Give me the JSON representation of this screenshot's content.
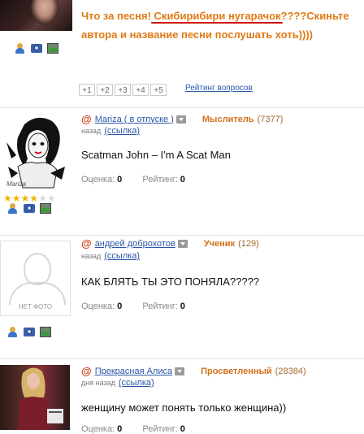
{
  "question": {
    "text_before": "Что за песня! ",
    "text_highlight": "Скибирибири нугарачок",
    "text_after": "????Скиньте автора и название песни послушать хоть))))",
    "votes": [
      "+1",
      "+2",
      "+3",
      "+4",
      "+5"
    ],
    "rating_link": "Рейтинг вопросов"
  },
  "answers": [
    {
      "author": "Mariza ( в отпуске )",
      "rank": "Мыслитель",
      "points": "(7377)",
      "time": "назад",
      "link": "(ссылка)",
      "text": "Scatman John – I'm A Scat Man",
      "score_label": "Оценка:",
      "score": "0",
      "rating_label": "Рейтинг:",
      "rating": "0",
      "avatar_caption": "Mariza"
    },
    {
      "author": "андрей доброхотов",
      "rank": "Ученик",
      "points": "(129)",
      "time": "назад",
      "link": "(ссылка)",
      "text": "КАК БЛЯТЬ ТЫ ЭТО ПОНЯЛА?????",
      "score_label": "Оценка:",
      "score": "0",
      "rating_label": "Рейтинг:",
      "rating": "0",
      "avatar_caption": "НЕТ ФОТО"
    },
    {
      "author": "Прекрасная Алиса",
      "rank": "Просветленный",
      "points": "(28384)",
      "time": "дня назад",
      "link": "(ссылка)",
      "text": "женщину может понять только женщина))",
      "score_label": "Оценка:",
      "score": "0",
      "rating_label": "Рейтинг:",
      "rating": "0"
    }
  ],
  "stars": {
    "filled": 4,
    "total": 6
  },
  "colors": {
    "accent": "#e07a15",
    "link": "#2a56a8",
    "highlight_underline": "#d01010"
  },
  "icons": [
    "user-icon",
    "camera-icon",
    "photo-icon"
  ]
}
